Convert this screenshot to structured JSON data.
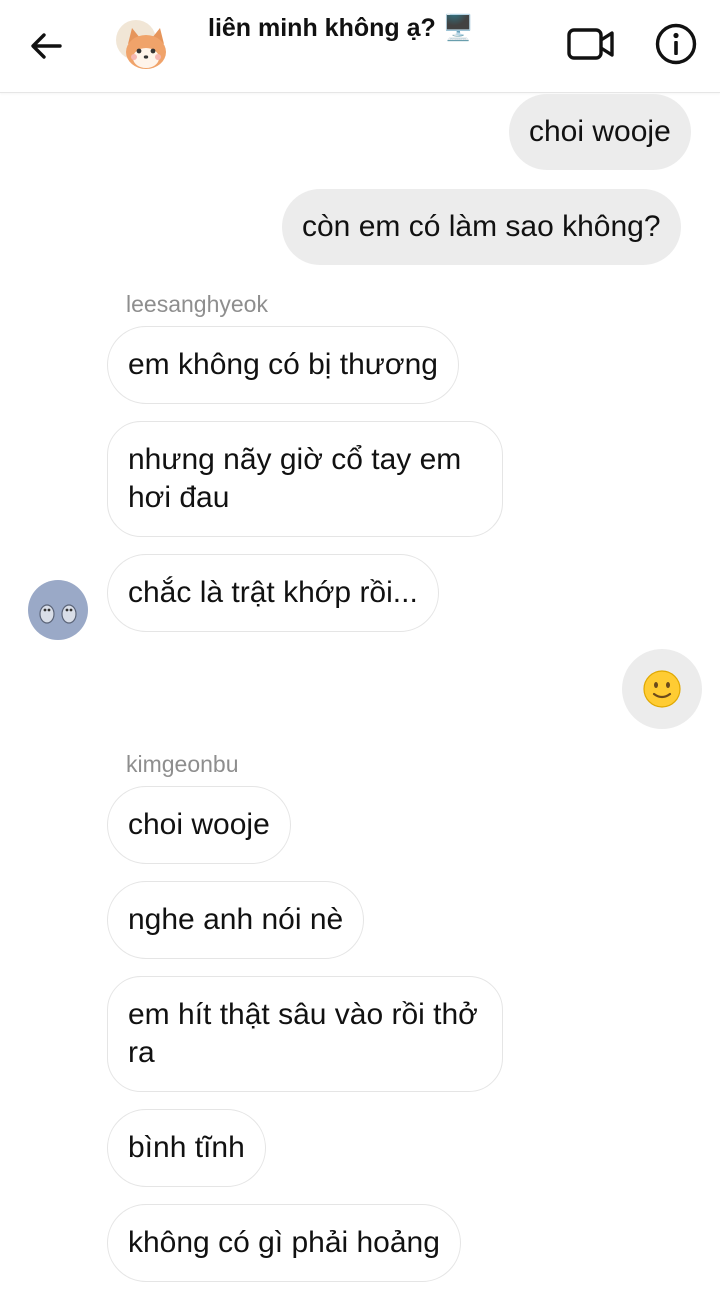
{
  "header": {
    "title": "liên minh không ạ?",
    "title_emoji": "🖥️"
  },
  "messages": {
    "out_1": "choi wooje",
    "out_2": "còn em có làm sao không?",
    "sender_1": "leesanghyeok",
    "in_1": "em không có bị thương",
    "in_2": "nhưng nãy giờ cổ tay em hơi đau",
    "in_3": "chắc là trật khớp rồi...",
    "reaction_emoji": "🙂",
    "sender_2": "kimgeonbu",
    "in_4": "choi wooje",
    "in_5": "nghe anh nói nè",
    "in_6": "em hít thật sâu vào rồi thở ra",
    "in_7": "bình tĩnh",
    "in_8": "không có gì phải hoảng"
  }
}
